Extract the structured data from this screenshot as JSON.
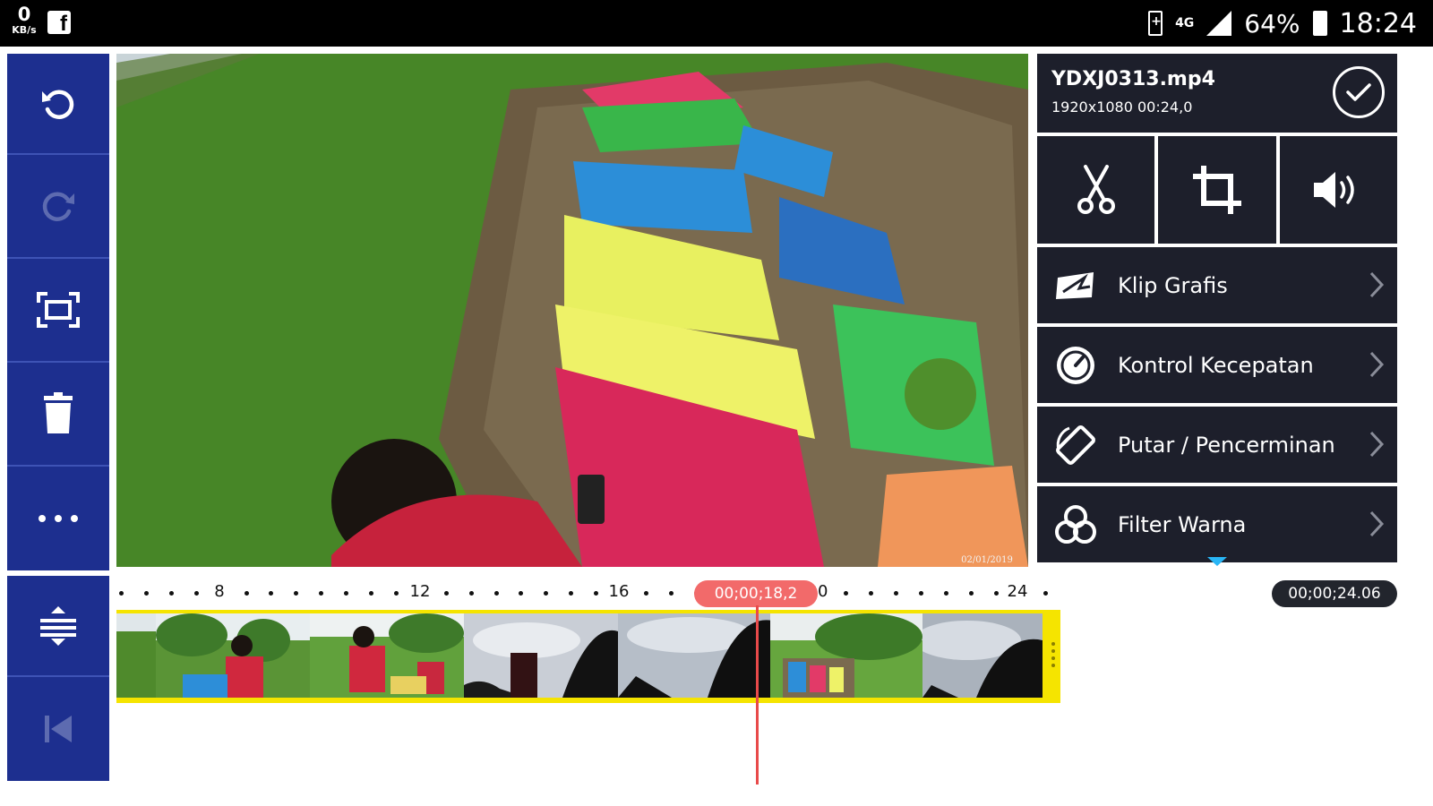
{
  "status_bar": {
    "net_speed_value": "0",
    "net_speed_unit": "KB/s",
    "network_type": "4G",
    "battery_percent": "64%",
    "time": "18:24"
  },
  "left_toolbar": {
    "buttons": [
      "undo-icon",
      "redo-icon",
      "fullscreen-icon",
      "delete-icon",
      "more-icon"
    ],
    "bottom_buttons": [
      "expand-timeline-icon",
      "skip-to-start-icon"
    ]
  },
  "clip_panel": {
    "file_name": "YDXJ0313.mp4",
    "file_meta": "1920x1080  00:24,0",
    "tools": [
      "scissors-icon",
      "crop-icon",
      "volume-icon"
    ],
    "menu": [
      {
        "label": "Klip Grafis",
        "icon": "clip-graphics-icon"
      },
      {
        "label": "Kontrol Kecepatan",
        "icon": "speedometer-icon"
      },
      {
        "label": "Putar / Pencerminan",
        "icon": "rotate-icon"
      },
      {
        "label": "Filter Warna",
        "icon": "color-filter-icon"
      }
    ]
  },
  "timeline": {
    "ruler_labels": [
      "8",
      "12",
      "16",
      "20",
      "24"
    ],
    "current_time": "00;00;18,2",
    "total_duration": "00;00;24.06"
  },
  "preview": {
    "watermark": "02/01/2019"
  },
  "colors": {
    "toolbar_blue": "#1d2f8f",
    "panel_dark": "#1d1f2b",
    "playhead_red": "#e84a4a",
    "clip_yellow": "#f5e400"
  }
}
